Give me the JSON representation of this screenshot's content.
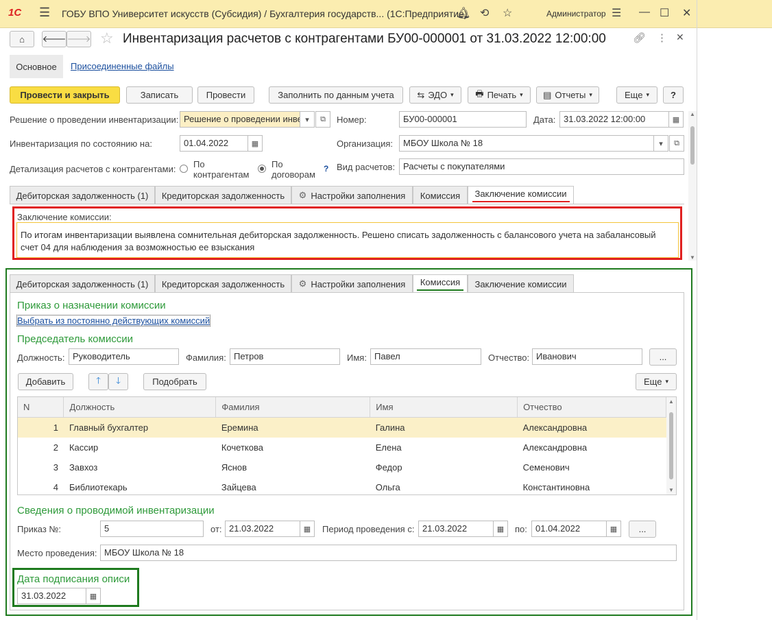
{
  "window": {
    "title": "ГОБУ ВПО Университет искусств (Субсидия) / Бухгалтерия государств... (1С:Предприятие)",
    "user": "Администратор"
  },
  "document": {
    "title": "Инвентаризация расчетов с контрагентами БУ00-000001 от 31.03.2022 12:00:00"
  },
  "nav_tabs": [
    "Основное",
    "Присоединенные файлы"
  ],
  "toolbar": {
    "post_close": "Провести и закрыть",
    "save": "Записать",
    "post": "Провести",
    "fill": "Заполнить по данным учета",
    "edo": "ЭДО",
    "print": "Печать",
    "reports": "Отчеты",
    "more": "Еще",
    "help": "?"
  },
  "header": {
    "decision_label": "Решение о проведении инвентаризации:",
    "decision_value": "Решение о проведении инве",
    "inv_date_label": "Инвентаризация по состоянию на:",
    "inv_date_value": "01.04.2022",
    "detail_label": "Детализация расчетов с контрагентами:",
    "radio_contractors": "По контрагентам",
    "radio_contracts": "По договорам",
    "help": "?",
    "number_label": "Номер:",
    "number_value": "БУ00-000001",
    "date_label": "Дата:",
    "date_value": "31.03.2022 12:00:00",
    "org_label": "Организация:",
    "org_value": "МБОУ Школа № 18",
    "settle_label": "Вид расчетов:",
    "settle_value": "Расчеты с покупателями"
  },
  "tabs": [
    "Дебиторская задолженность (1)",
    "Кредиторская задолженность",
    "Настройки заполнения",
    "Комиссия",
    "Заключение комиссии"
  ],
  "conclusion": {
    "label": "Заключение комиссии:",
    "text": "По итогам инвентаризации выявлена сомнительная дебиторская задолженность. Решено списать задолженность с балансового учета на забалансовый счет 04 для наблюдения за возможностью ее взыскания"
  },
  "commission": {
    "order_title": "Приказ о назначении комиссии",
    "choose_link": "Выбрать из постоянно действующих комиссий",
    "chair_title": "Председатель комиссии",
    "position_label": "Должность:",
    "position_value": "Руководитель",
    "surname_label": "Фамилия:",
    "surname_value": "Петров",
    "name_label": "Имя:",
    "name_value": "Павел",
    "patronymic_label": "Отчество:",
    "patronymic_value": "Иванович",
    "ellipsis": "...",
    "add_button": "Добавить",
    "pick_button": "Подобрать",
    "more_button": "Еще",
    "columns": [
      "N",
      "Должность",
      "Фамилия",
      "Имя",
      "Отчество"
    ],
    "rows": [
      [
        "1",
        "Главный бухгалтер",
        "Еремина",
        "Галина",
        "Александровна"
      ],
      [
        "2",
        "Кассир",
        "Кочеткова",
        "Елена",
        "Александровна"
      ],
      [
        "3",
        "Завхоз",
        "Яснов",
        "Федор",
        "Семенович"
      ],
      [
        "4",
        "Библиотекарь",
        "Зайцева",
        "Ольга",
        "Константиновна"
      ]
    ]
  },
  "inventory": {
    "title": "Сведения о проводимой инвентаризации",
    "order_label": "Приказ №:",
    "order_value": "5",
    "from_label": "от:",
    "from_value": "21.03.2022",
    "period_label": "Период проведения с:",
    "period_from": "21.03.2022",
    "to_label": "по:",
    "period_to": "01.04.2022",
    "ellipsis": "...",
    "place_label": "Место проведения:",
    "place_value": "МБОУ Школа № 18",
    "sign_title": "Дата подписания описи",
    "sign_value": "31.03.2022"
  },
  "colors": {
    "titlebar": "#fbedb0",
    "primary_button": "#f9dd43",
    "section_green": "#2e9a3a",
    "highlight_red": "#e02020",
    "highlight_green": "#1e7a1e",
    "link": "#1b4f9e"
  }
}
